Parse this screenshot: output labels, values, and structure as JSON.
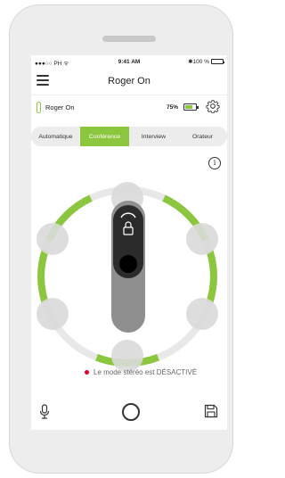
{
  "status_bar": {
    "carrier": "●●●○○ PH ᯤ",
    "time": "9:41 AM",
    "battery": "✱100 %"
  },
  "nav": {
    "title": "Roger On",
    "menu_icon": "hamburger-icon"
  },
  "device": {
    "name": "Roger On",
    "battery_percent": "75%",
    "battery_level": 0.75,
    "settings_icon": "gear-icon"
  },
  "modes": [
    {
      "label": "Automatique",
      "active": false
    },
    {
      "label": "Conférence",
      "active": true
    },
    {
      "label": "Interview",
      "active": false
    },
    {
      "label": "Orateur",
      "active": false
    }
  ],
  "info_icon": "info-icon",
  "status_message": "Le mode stéréo est DÉSACTIVÉ",
  "toolbar": {
    "mic_icon": "microphone-icon",
    "circle_icon": "circle-icon",
    "save_icon": "save-icon"
  },
  "colors": {
    "accent": "#8cc63f",
    "inactive_ring": "#e8e8e8",
    "seat": "#d9d9d9",
    "device_body": "#8f8f8f",
    "status_dot": "#e4002b"
  }
}
